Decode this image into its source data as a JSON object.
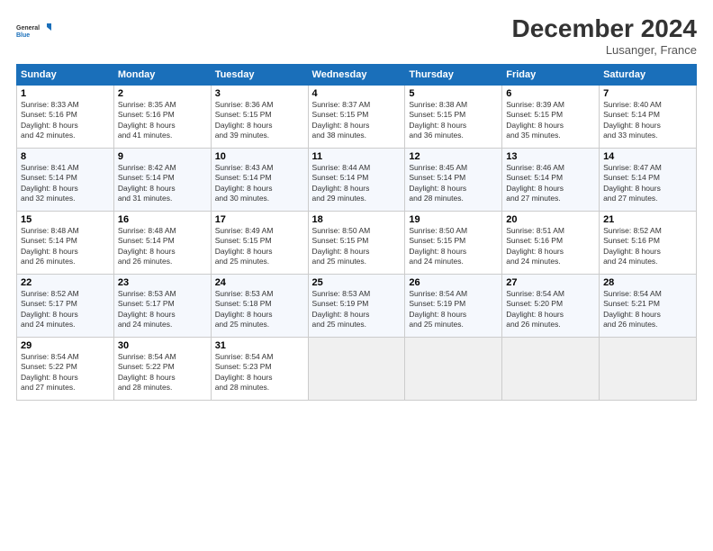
{
  "logo": {
    "line1": "General",
    "line2": "Blue"
  },
  "title": "December 2024",
  "subtitle": "Lusanger, France",
  "days_header": [
    "Sunday",
    "Monday",
    "Tuesday",
    "Wednesday",
    "Thursday",
    "Friday",
    "Saturday"
  ],
  "rows": [
    [
      {
        "day": "1",
        "info": "Sunrise: 8:33 AM\nSunset: 5:16 PM\nDaylight: 8 hours\nand 42 minutes."
      },
      {
        "day": "2",
        "info": "Sunrise: 8:35 AM\nSunset: 5:16 PM\nDaylight: 8 hours\nand 41 minutes."
      },
      {
        "day": "3",
        "info": "Sunrise: 8:36 AM\nSunset: 5:15 PM\nDaylight: 8 hours\nand 39 minutes."
      },
      {
        "day": "4",
        "info": "Sunrise: 8:37 AM\nSunset: 5:15 PM\nDaylight: 8 hours\nand 38 minutes."
      },
      {
        "day": "5",
        "info": "Sunrise: 8:38 AM\nSunset: 5:15 PM\nDaylight: 8 hours\nand 36 minutes."
      },
      {
        "day": "6",
        "info": "Sunrise: 8:39 AM\nSunset: 5:15 PM\nDaylight: 8 hours\nand 35 minutes."
      },
      {
        "day": "7",
        "info": "Sunrise: 8:40 AM\nSunset: 5:14 PM\nDaylight: 8 hours\nand 33 minutes."
      }
    ],
    [
      {
        "day": "8",
        "info": "Sunrise: 8:41 AM\nSunset: 5:14 PM\nDaylight: 8 hours\nand 32 minutes."
      },
      {
        "day": "9",
        "info": "Sunrise: 8:42 AM\nSunset: 5:14 PM\nDaylight: 8 hours\nand 31 minutes."
      },
      {
        "day": "10",
        "info": "Sunrise: 8:43 AM\nSunset: 5:14 PM\nDaylight: 8 hours\nand 30 minutes."
      },
      {
        "day": "11",
        "info": "Sunrise: 8:44 AM\nSunset: 5:14 PM\nDaylight: 8 hours\nand 29 minutes."
      },
      {
        "day": "12",
        "info": "Sunrise: 8:45 AM\nSunset: 5:14 PM\nDaylight: 8 hours\nand 28 minutes."
      },
      {
        "day": "13",
        "info": "Sunrise: 8:46 AM\nSunset: 5:14 PM\nDaylight: 8 hours\nand 27 minutes."
      },
      {
        "day": "14",
        "info": "Sunrise: 8:47 AM\nSunset: 5:14 PM\nDaylight: 8 hours\nand 27 minutes."
      }
    ],
    [
      {
        "day": "15",
        "info": "Sunrise: 8:48 AM\nSunset: 5:14 PM\nDaylight: 8 hours\nand 26 minutes."
      },
      {
        "day": "16",
        "info": "Sunrise: 8:48 AM\nSunset: 5:14 PM\nDaylight: 8 hours\nand 26 minutes."
      },
      {
        "day": "17",
        "info": "Sunrise: 8:49 AM\nSunset: 5:15 PM\nDaylight: 8 hours\nand 25 minutes."
      },
      {
        "day": "18",
        "info": "Sunrise: 8:50 AM\nSunset: 5:15 PM\nDaylight: 8 hours\nand 25 minutes."
      },
      {
        "day": "19",
        "info": "Sunrise: 8:50 AM\nSunset: 5:15 PM\nDaylight: 8 hours\nand 24 minutes."
      },
      {
        "day": "20",
        "info": "Sunrise: 8:51 AM\nSunset: 5:16 PM\nDaylight: 8 hours\nand 24 minutes."
      },
      {
        "day": "21",
        "info": "Sunrise: 8:52 AM\nSunset: 5:16 PM\nDaylight: 8 hours\nand 24 minutes."
      }
    ],
    [
      {
        "day": "22",
        "info": "Sunrise: 8:52 AM\nSunset: 5:17 PM\nDaylight: 8 hours\nand 24 minutes."
      },
      {
        "day": "23",
        "info": "Sunrise: 8:53 AM\nSunset: 5:17 PM\nDaylight: 8 hours\nand 24 minutes."
      },
      {
        "day": "24",
        "info": "Sunrise: 8:53 AM\nSunset: 5:18 PM\nDaylight: 8 hours\nand 25 minutes."
      },
      {
        "day": "25",
        "info": "Sunrise: 8:53 AM\nSunset: 5:19 PM\nDaylight: 8 hours\nand 25 minutes."
      },
      {
        "day": "26",
        "info": "Sunrise: 8:54 AM\nSunset: 5:19 PM\nDaylight: 8 hours\nand 25 minutes."
      },
      {
        "day": "27",
        "info": "Sunrise: 8:54 AM\nSunset: 5:20 PM\nDaylight: 8 hours\nand 26 minutes."
      },
      {
        "day": "28",
        "info": "Sunrise: 8:54 AM\nSunset: 5:21 PM\nDaylight: 8 hours\nand 26 minutes."
      }
    ],
    [
      {
        "day": "29",
        "info": "Sunrise: 8:54 AM\nSunset: 5:22 PM\nDaylight: 8 hours\nand 27 minutes."
      },
      {
        "day": "30",
        "info": "Sunrise: 8:54 AM\nSunset: 5:22 PM\nDaylight: 8 hours\nand 28 minutes."
      },
      {
        "day": "31",
        "info": "Sunrise: 8:54 AM\nSunset: 5:23 PM\nDaylight: 8 hours\nand 28 minutes."
      },
      {
        "day": "",
        "info": ""
      },
      {
        "day": "",
        "info": ""
      },
      {
        "day": "",
        "info": ""
      },
      {
        "day": "",
        "info": ""
      }
    ]
  ]
}
